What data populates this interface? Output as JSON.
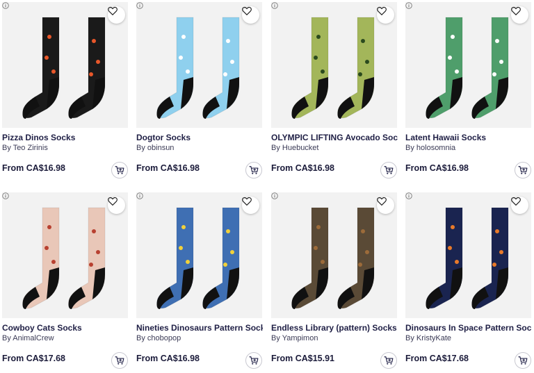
{
  "products": [
    {
      "title": "Pizza Dinos Socks",
      "artist": "By Teo Zirinis",
      "price": "From CA$16.98",
      "sock_color": "#1a1a1a",
      "accent": "#e8572a"
    },
    {
      "title": "Dogtor Socks",
      "artist": "By obinsun",
      "price": "From CA$16.98",
      "sock_color": "#8fd0ee",
      "accent": "#ffffff"
    },
    {
      "title": "OLYMPIC LIFTING Avocado Socks",
      "artist": "By Huebucket",
      "price": "From CA$16.98",
      "sock_color": "#a3b65a",
      "accent": "#2b4a1e"
    },
    {
      "title": "Latent Hawaii Socks",
      "artist": "By holosomnia",
      "price": "From CA$16.98",
      "sock_color": "#4f9e6b",
      "accent": "#ffffff"
    },
    {
      "title": "Cowboy Cats Socks",
      "artist": "By AnimalCrew",
      "price": "From CA$17.68",
      "sock_color": "#e9c7b8",
      "accent": "#b84030"
    },
    {
      "title": "Nineties Dinosaurs Pattern Socks",
      "artist": "By chobopop",
      "price": "From CA$16.98",
      "sock_color": "#3f6fb3",
      "accent": "#f2d13a"
    },
    {
      "title": "Endless Library (pattern) Socks",
      "artist": "By Yampimon",
      "price": "From CA$15.91",
      "sock_color": "#5a4a36",
      "accent": "#9c6b3a"
    },
    {
      "title": "Dinosaurs In Space Pattern Socks",
      "artist": "By KristyKate",
      "price": "From CA$17.68",
      "sock_color": "#1a2450",
      "accent": "#e87a2a"
    }
  ],
  "icons": {
    "favorite": "heart-icon",
    "cart": "add-to-cart-icon",
    "info": "info-icon"
  }
}
